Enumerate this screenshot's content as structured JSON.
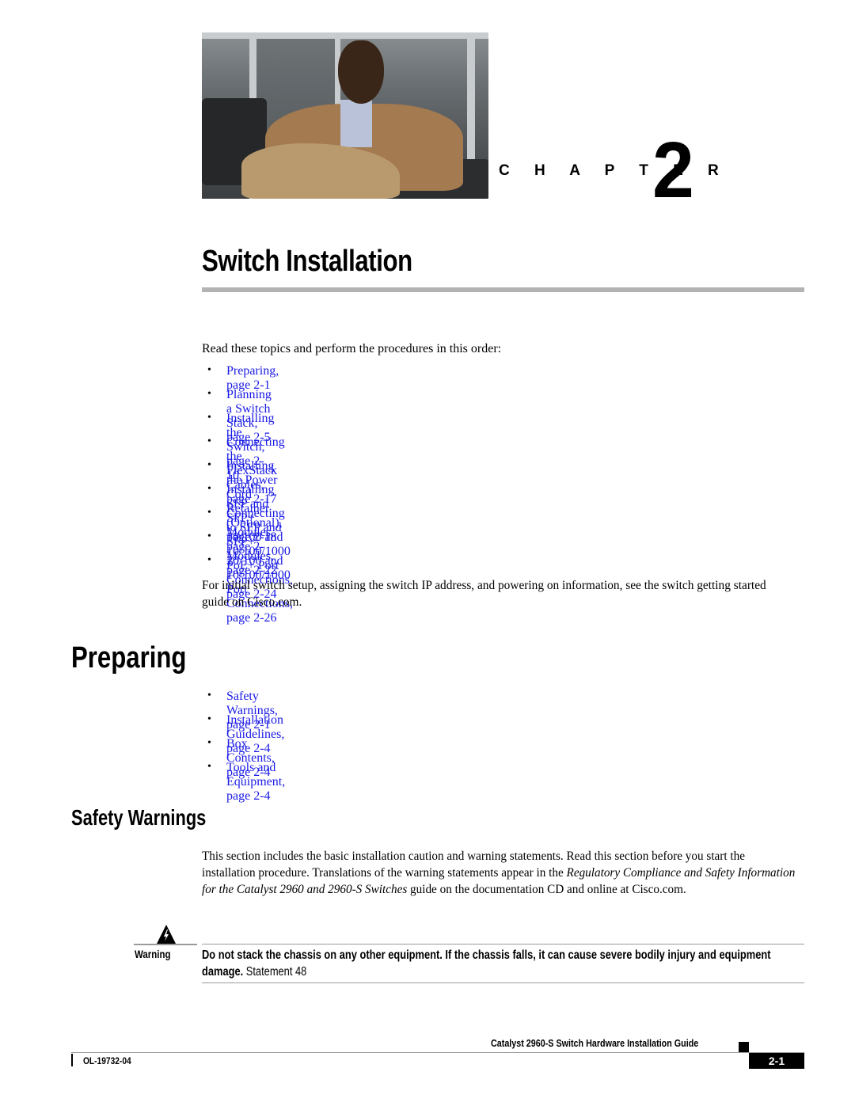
{
  "chapter": {
    "label": "C H A P T E R",
    "number": "2",
    "photo_alt": "man-seated-photo"
  },
  "title": "Switch Installation",
  "intro": "Read these topics and perform the procedures in this order:",
  "topics": [
    {
      "label": "Preparing, page 2-1"
    },
    {
      "label": "Planning a Switch Stack, page 2-5"
    },
    {
      "label": "Installing the Switch, page 2-10"
    },
    {
      "label": "Connecting the FlexStack Cables, page 2-17"
    },
    {
      "label": "Installing the Power Cord Retainer (Optional), page 2-18"
    },
    {
      "label": "Installing SFP and SFP+ Modules, page 2-20"
    },
    {
      "label": "Connecting to SFP and SFP+ Modules, page 2-22"
    },
    {
      "label": "10/100 and 10/100/1000 PoE+ Port Connections, page 2-24"
    },
    {
      "label": "10/100 and 10/100/1000 Port Connections, page 2-26"
    }
  ],
  "setup_note": "For initial switch setup, assigning the switch IP address, and powering on information, see the switch getting started guide on Cisco.com.",
  "preparing": {
    "heading": "Preparing",
    "topics": [
      {
        "label": "Safety Warnings, page 2-1"
      },
      {
        "label": "Installation Guidelines, page 2-4"
      },
      {
        "label": "Box Contents, page 2-4"
      },
      {
        "label": "Tools and Equipment, page 2-4"
      }
    ]
  },
  "safety": {
    "heading": "Safety Warnings",
    "para_part1": "This section includes the basic installation caution and warning statements. Read this section before you start the installation procedure. Translations of the warning statements appear in the ",
    "para_italic": "Regulatory Compliance and Safety Information for the Catalyst 2960 and 2960-S Switches",
    "para_part2": " guide on the documentation CD and online at Cisco.com.",
    "warning": {
      "label": "Warning",
      "icon": "warning-triangle-icon",
      "text": "Do not stack the chassis on any other equipment. If the chassis falls, it can cause severe bodily injury and equipment damage.",
      "statement": " Statement 48"
    }
  },
  "footer": {
    "guide_title": "Catalyst 2960-S Switch Hardware Installation Guide",
    "doc_code": "OL-19732-04",
    "page_number": "2-1"
  },
  "colors": {
    "link": "#1a1ae6",
    "rule": "#b3b3b3"
  }
}
